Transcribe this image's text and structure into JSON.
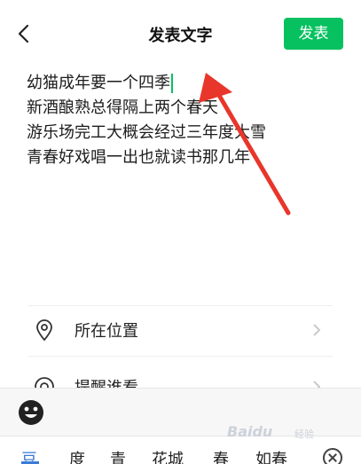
{
  "header": {
    "title": "发表文字",
    "publish_label": "发表"
  },
  "composer": {
    "lines": [
      "幼猫成年要一个四季",
      "新酒酿熟总得隔上两个春天",
      "游乐场完工大概会经过三年度大雪",
      "青春好戏唱一出也就读书那几年"
    ]
  },
  "options": [
    {
      "label": "所在位置",
      "icon": "location-pin-icon"
    },
    {
      "label": "提醒谁看",
      "icon": "at-icon"
    }
  ],
  "keyboard": {
    "candidates": [
      "豆",
      "度",
      "青",
      "花城",
      "春",
      "如春"
    ]
  },
  "watermark": {
    "text": "Baidu",
    "sub": "经验"
  },
  "colors": {
    "accent": "#07c160",
    "arrow": "#e8362b",
    "candidate_active": "#3a7bd5"
  }
}
